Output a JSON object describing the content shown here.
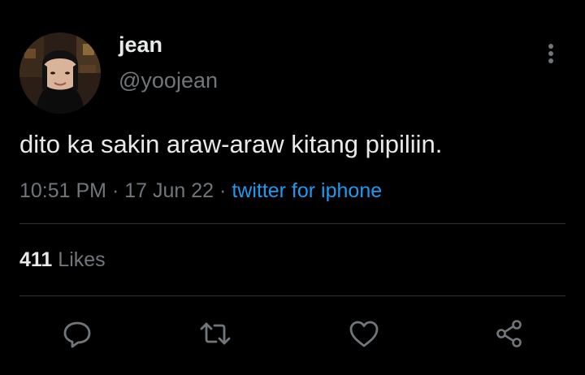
{
  "user": {
    "display_name": "jean",
    "handle": "@yoojean"
  },
  "tweet": {
    "text": "dito ka sakin araw-araw kitang pipiliin."
  },
  "meta": {
    "time": "10:51 PM",
    "separator": "·",
    "date": "17 Jun 22",
    "source": "twitter for iphone"
  },
  "stats": {
    "likes_count": "411",
    "likes_label": "Likes"
  },
  "icons": {
    "more": "more-vertical-icon",
    "reply": "reply-icon",
    "retweet": "retweet-icon",
    "like": "heart-icon",
    "share": "share-icon"
  },
  "colors": {
    "background": "#000000",
    "text": "#e7e9ea",
    "muted": "#71767b",
    "link": "#1d9bf0",
    "divider": "#2f3336"
  }
}
